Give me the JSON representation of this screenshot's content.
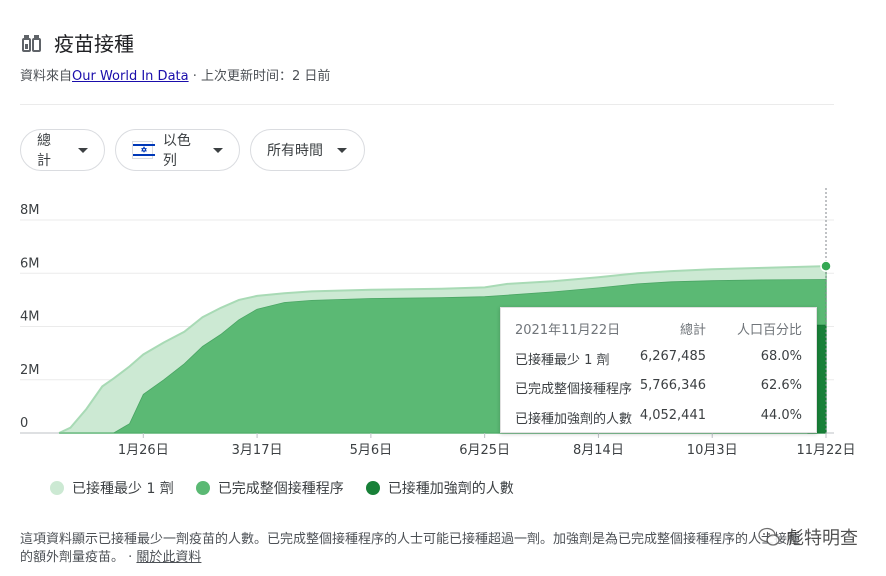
{
  "header": {
    "title": "疫苗接種",
    "source_prefix": "資料來自",
    "source_link": "Our World In Data",
    "source_suffix": " · 上次更新时间：2 日前"
  },
  "filters": {
    "metric": "總計",
    "country": "以色列",
    "time_range": "所有時間"
  },
  "tooltip": {
    "date": "2021年11月22日",
    "col_total": "總計",
    "col_pct": "人口百分比",
    "rows": [
      {
        "label": "已接種最少 1 劑",
        "total": "6,267,485",
        "pct": "68.0%"
      },
      {
        "label": "已完成整個接種程序",
        "total": "5,766,346",
        "pct": "62.6%"
      },
      {
        "label": "已接種加強劑的人數",
        "total": "4,052,441",
        "pct": "44.0%"
      }
    ]
  },
  "legend": [
    {
      "label": "已接種最少 1 劑",
      "color": "#cce9d3"
    },
    {
      "label": "已完成整個接種程序",
      "color": "#5bb974"
    },
    {
      "label": "已接種加強劑的人數",
      "color": "#188038"
    }
  ],
  "footnote": {
    "text": "這項資料顯示已接種最少一劑疫苗的人數。已完成整個接種程序的人士可能已接種超過一劑。加強劑是為已完成整個接種程序的人士接種的額外劑量疫苗。",
    "link": "關於此資料",
    "sep": " · "
  },
  "watermark": "彪特明查",
  "chart_data": {
    "type": "area",
    "title": "",
    "xlabel": "",
    "ylabel": "",
    "ylim": [
      0,
      8000000
    ],
    "yticks": [
      0,
      2000000,
      4000000,
      6000000,
      8000000
    ],
    "ytick_labels": [
      "0",
      "2M",
      "4M",
      "6M",
      "8M"
    ],
    "xtick_labels": [
      "1月26日",
      "3月17日",
      "5月6日",
      "6月25日",
      "8月14日",
      "10月3日",
      "11月22日"
    ],
    "xtick_dates": [
      "2021-01-26",
      "2021-03-17",
      "2021-05-06",
      "2021-06-25",
      "2021-08-14",
      "2021-10-03",
      "2021-11-22"
    ],
    "x": [
      "2020-12-20",
      "2020-12-25",
      "2021-01-01",
      "2021-01-08",
      "2021-01-13",
      "2021-01-20",
      "2021-01-26",
      "2021-02-04",
      "2021-02-13",
      "2021-02-21",
      "2021-03-01",
      "2021-03-09",
      "2021-03-17",
      "2021-03-29",
      "2021-04-10",
      "2021-05-06",
      "2021-06-06",
      "2021-06-25",
      "2021-07-05",
      "2021-07-25",
      "2021-08-14",
      "2021-08-31",
      "2021-09-15",
      "2021-10-03",
      "2021-10-25",
      "2021-11-22"
    ],
    "series": [
      {
        "name": "已接種最少 1 劑",
        "color": "#cce9d3",
        "values": [
          0,
          200000,
          900000,
          1750000,
          2050000,
          2500000,
          2950000,
          3400000,
          3800000,
          4350000,
          4700000,
          5000000,
          5150000,
          5250000,
          5320000,
          5380000,
          5420000,
          5470000,
          5600000,
          5700000,
          5850000,
          6000000,
          6080000,
          6150000,
          6200000,
          6267485
        ]
      },
      {
        "name": "已完成整個接種程序",
        "color": "#5bb974",
        "values": [
          0,
          0,
          0,
          0,
          0,
          350000,
          1450000,
          2000000,
          2600000,
          3250000,
          3700000,
          4250000,
          4650000,
          4900000,
          4980000,
          5050000,
          5080000,
          5120000,
          5180000,
          5300000,
          5450000,
          5600000,
          5680000,
          5720000,
          5750000,
          5766346
        ]
      },
      {
        "name": "已接種加強劑的人數",
        "color": "#188038",
        "values": [
          0,
          0,
          0,
          0,
          0,
          0,
          0,
          0,
          0,
          0,
          0,
          0,
          0,
          0,
          0,
          0,
          0,
          0,
          0,
          0,
          0,
          0,
          0,
          0,
          0,
          4052441
        ]
      }
    ],
    "grid": true,
    "legend_position": "bottom",
    "highlight_date": "2021-11-22"
  }
}
